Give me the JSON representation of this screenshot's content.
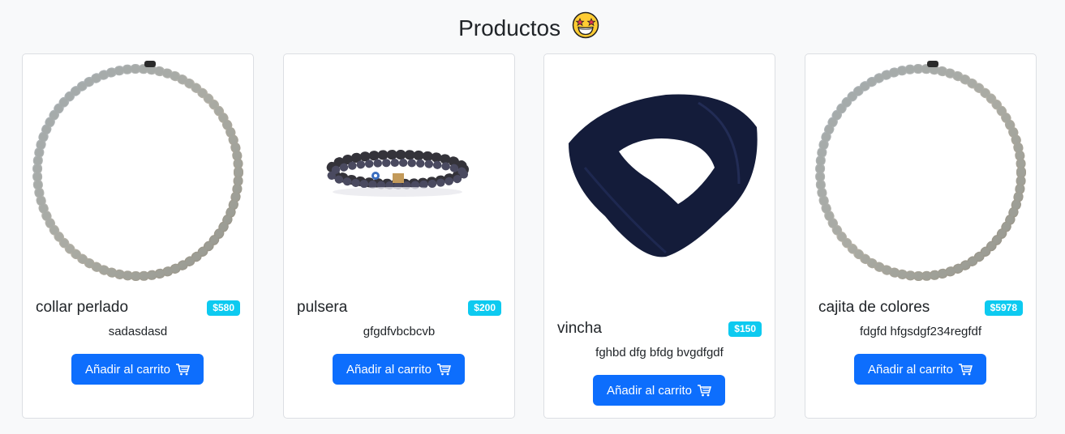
{
  "page": {
    "title": "Productos",
    "title_emoji": "star-struck-emoji-icon"
  },
  "products": [
    {
      "name": "collar perlado",
      "price": "$580",
      "description": "sadasdasd",
      "button_label": "Añadir al carrito",
      "image": "pearl-necklace-image"
    },
    {
      "name": "pulsera",
      "price": "$200",
      "description": "gfgdfvbcbcvb",
      "button_label": "Añadir al carrito",
      "image": "beaded-bracelet-image"
    },
    {
      "name": "vincha",
      "price": "$150",
      "description": "fghbd dfg bfdg bvgdfgdf",
      "button_label": "Añadir al carrito",
      "image": "navy-headband-image"
    },
    {
      "name": "cajita de colores",
      "price": "$5978",
      "description": "fdgfd hfgsdgf234regfdf",
      "button_label": "Añadir al carrito",
      "image": "pearl-necklace-image"
    }
  ],
  "colors": {
    "background": "#f8f9fa",
    "button": "#0d6efd",
    "badge": "#0dcaf0"
  }
}
